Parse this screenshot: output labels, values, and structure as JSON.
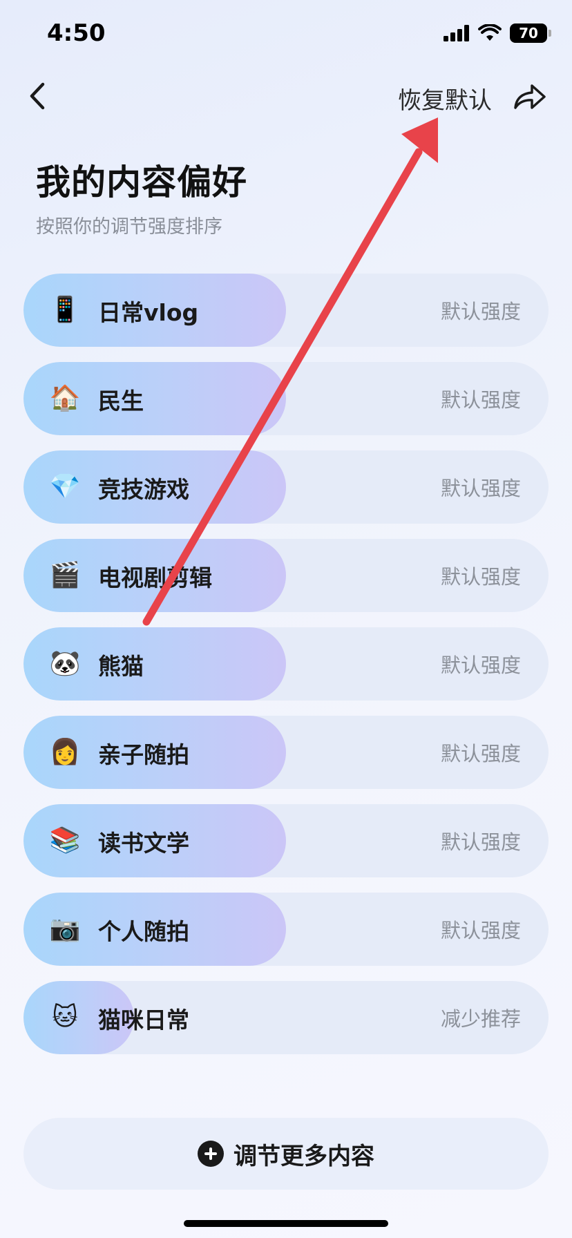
{
  "status_bar": {
    "time": "4:50",
    "battery": "70"
  },
  "nav": {
    "reset_label": "恢复默认"
  },
  "header": {
    "title": "我的内容偏好",
    "subtitle": "按照你的调节强度排序"
  },
  "items": [
    {
      "icon": "phone-vlog-icon",
      "emoji": "📱",
      "label": "日常vlog",
      "status": "默认强度",
      "level": 0.5
    },
    {
      "icon": "house-hand-icon",
      "emoji": "🏠",
      "label": "民生",
      "status": "默认强度",
      "level": 0.5
    },
    {
      "icon": "gem-icon",
      "emoji": "💎",
      "label": "竞技游戏",
      "status": "默认强度",
      "level": 0.5
    },
    {
      "icon": "clapperboard-icon",
      "emoji": "🎬",
      "label": "电视剧剪辑",
      "status": "默认强度",
      "level": 0.5
    },
    {
      "icon": "panda-icon",
      "emoji": "🐼",
      "label": "熊猫",
      "status": "默认强度",
      "level": 0.5
    },
    {
      "icon": "mother-baby-icon",
      "emoji": "👩",
      "label": "亲子随拍",
      "status": "默认强度",
      "level": 0.5
    },
    {
      "icon": "book-pen-icon",
      "emoji": "📚",
      "label": "读书文学",
      "status": "默认强度",
      "level": 0.5
    },
    {
      "icon": "camera-photo-icon",
      "emoji": "📷",
      "label": "个人随拍",
      "status": "默认强度",
      "level": 0.5
    },
    {
      "icon": "cat-bed-icon",
      "emoji": "🐱",
      "label": "猫咪日常",
      "status": "减少推荐",
      "level": 0.21
    }
  ],
  "more": {
    "label": "调节更多内容"
  },
  "annotation": {
    "color": "#e8434a"
  }
}
